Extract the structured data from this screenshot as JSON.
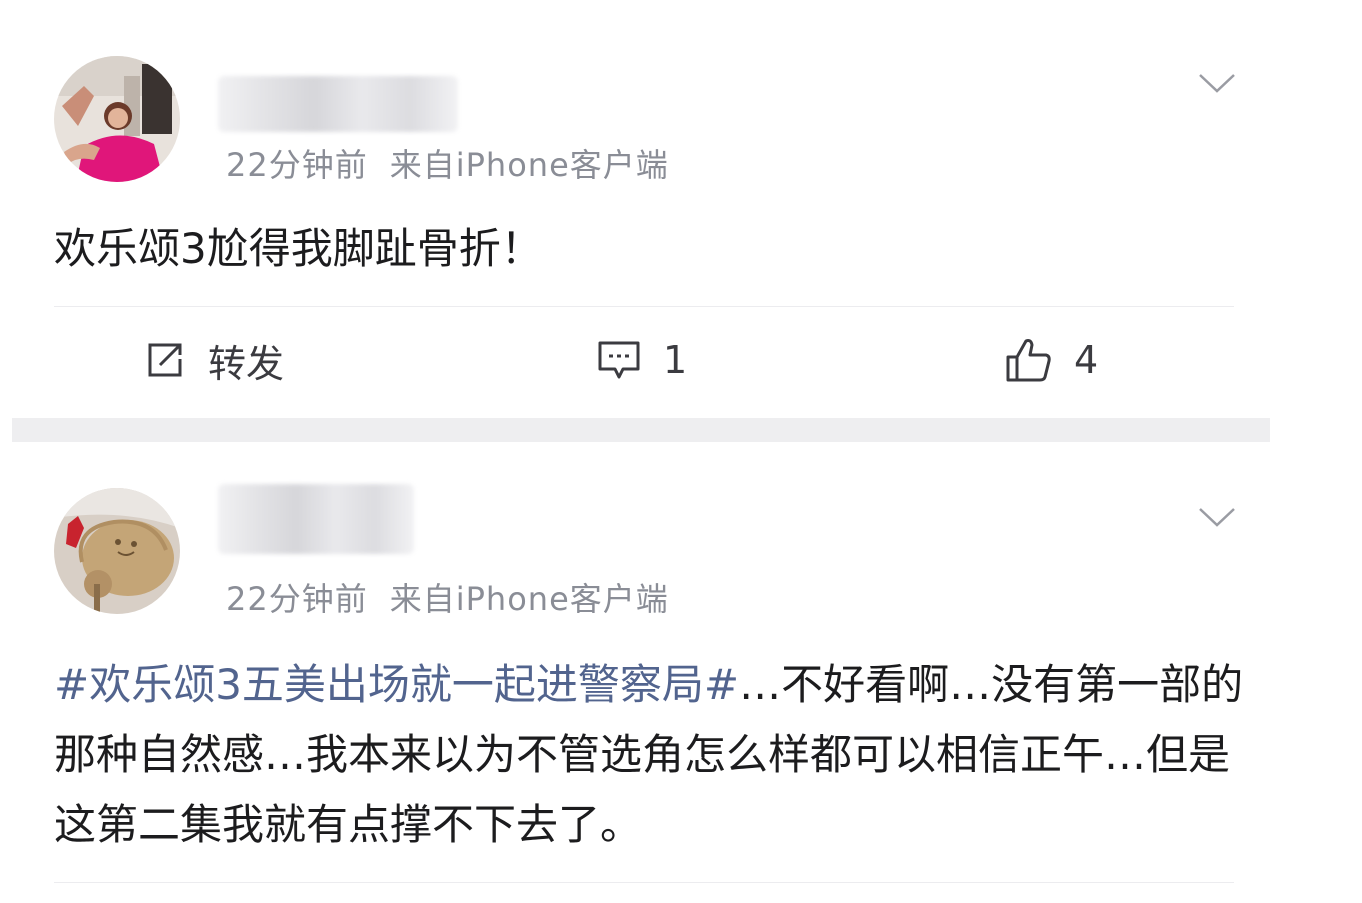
{
  "posts": [
    {
      "time": "22分钟前",
      "source": "来自iPhone客户端",
      "content": "欢乐颂3尬得我脚趾骨折！",
      "actions": {
        "repost_label": "转发",
        "comment_count": "1",
        "like_count": "4"
      },
      "icons": [
        "avatar",
        "chevron-down-icon",
        "repost-icon",
        "comment-icon",
        "like-icon"
      ]
    },
    {
      "time": "22分钟前",
      "source": "来自iPhone客户端",
      "hashtag": "#欢乐颂3五美出场就一起进警察局#",
      "content": "…不好看啊…没有第一部的那种自然感…我本来以为不管选角怎么样都可以相信正午…但是这第二集我就有点撑不下去了。",
      "icons": [
        "avatar",
        "chevron-down-icon"
      ]
    }
  ],
  "colors": {
    "text": "#1c1c1e",
    "meta": "#8a8d96",
    "hashtag": "#52648e",
    "separator": "#eeeef0"
  }
}
